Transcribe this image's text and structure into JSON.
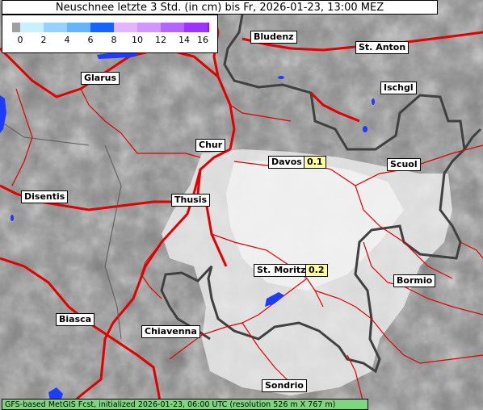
{
  "title": "Neuschnee letzte 3 Std. (in cm) bis Fr, 2026-01-23, 13:00 MEZ",
  "legend": {
    "ticks": [
      "0",
      "2",
      "4",
      "6",
      "8",
      "10",
      "12",
      "14",
      "16"
    ],
    "colors": [
      "#c8f0ff",
      "#96d2ff",
      "#64b4ff",
      "#3c8cff",
      "#1464ff",
      "#e6b4ff",
      "#c882ff",
      "#aa50ff",
      "#8c14ff"
    ],
    "start_color": "#a0a0a0"
  },
  "cities": [
    {
      "name": "Bludenz"
    },
    {
      "name": "St. Anton"
    },
    {
      "name": "Glarus"
    },
    {
      "name": "Ischgl"
    },
    {
      "name": "Chur"
    },
    {
      "name": "Davos",
      "value": "0.1"
    },
    {
      "name": "Scuol"
    },
    {
      "name": "Disentis"
    },
    {
      "name": "Thusis"
    },
    {
      "name": "St. Moritz",
      "value": "0.2"
    },
    {
      "name": "Bormio"
    },
    {
      "name": "Biasca"
    },
    {
      "name": "Chiavenna"
    },
    {
      "name": "Sondrio"
    }
  ],
  "footer": "GFS-based MetGIS Fcst, initialized 2026-01-23, 06:00 UTC  (resolution 526 m X 767 m)"
}
